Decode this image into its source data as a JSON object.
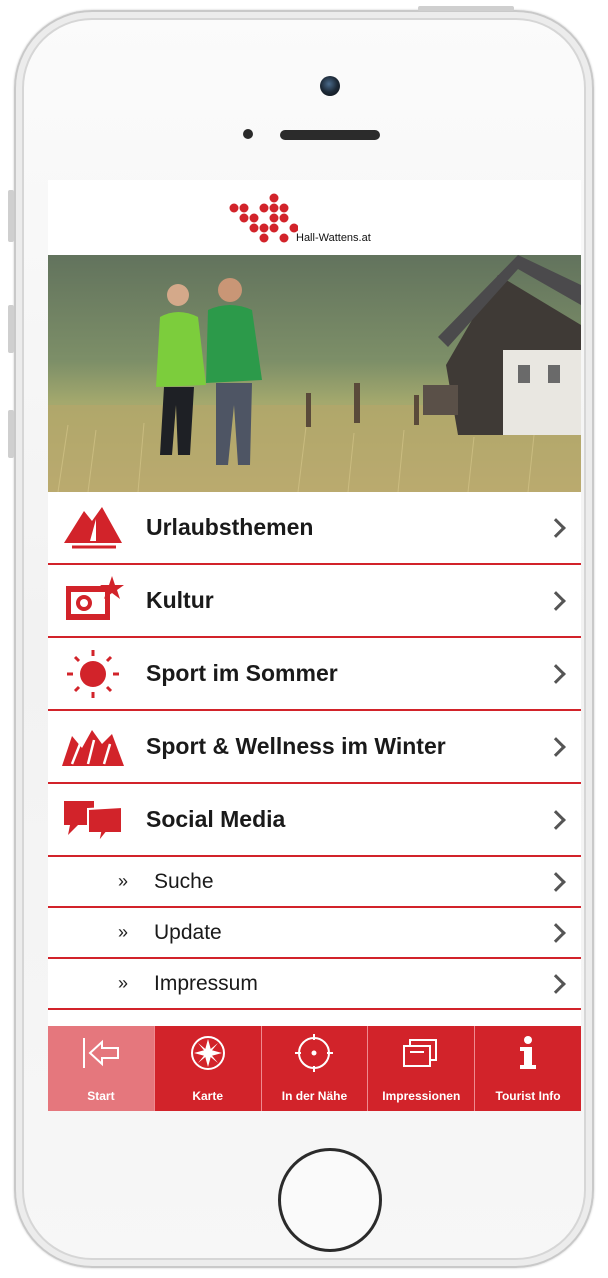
{
  "brand": {
    "logo_text": "Hall-Wattens.at",
    "accent": "#d2232a",
    "accent_light": "#e5777d"
  },
  "menu": {
    "items": [
      {
        "label": "Urlaubsthemen",
        "icon": "mountain-sailboat-icon"
      },
      {
        "label": "Kultur",
        "icon": "culture-icon"
      },
      {
        "label": "Sport im Sommer",
        "icon": "sun-icon"
      },
      {
        "label": "Sport & Wellness im Winter",
        "icon": "winter-mountains-icon"
      },
      {
        "label": "Social Media",
        "icon": "speech-bubbles-icon"
      }
    ],
    "sub_items": [
      {
        "prefix": "»",
        "label": "Suche"
      },
      {
        "prefix": "»",
        "label": "Update"
      },
      {
        "prefix": "»",
        "label": "Impressum"
      }
    ]
  },
  "tabbar": {
    "tabs": [
      {
        "label": "Start",
        "icon": "back-arrow-icon",
        "active": true
      },
      {
        "label": "Karte",
        "icon": "compass-icon",
        "active": false
      },
      {
        "label": "In der Nähe",
        "icon": "target-icon",
        "active": false
      },
      {
        "label": "Impressionen",
        "icon": "photos-icon",
        "active": false
      },
      {
        "label": "Tourist Info",
        "icon": "info-icon",
        "active": false
      }
    ]
  }
}
